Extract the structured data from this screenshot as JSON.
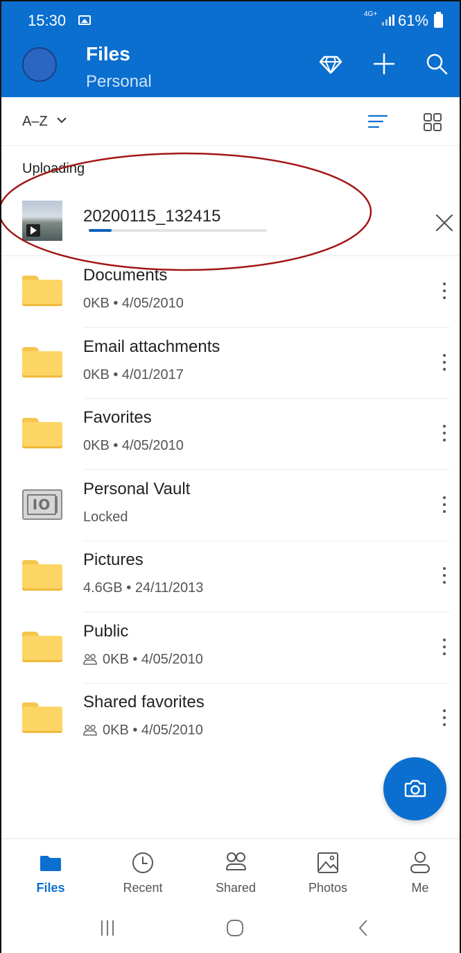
{
  "status_bar": {
    "time": "15:30",
    "network": "4G+",
    "battery": "61%"
  },
  "header": {
    "title": "Files",
    "subtitle": "Personal",
    "accent_color": "#0b6fd0"
  },
  "sort": {
    "label": "A–Z"
  },
  "uploading": {
    "section_label": "Uploading",
    "file_name": "20200115_132415",
    "progress": 0.13
  },
  "files": [
    {
      "name": "Documents",
      "meta": "0KB • 4/05/2010",
      "icon": "folder-icon",
      "shared": false
    },
    {
      "name": "Email attachments",
      "meta": "0KB • 4/01/2017",
      "icon": "folder-icon",
      "shared": false
    },
    {
      "name": "Favorites",
      "meta": "0KB • 4/05/2010",
      "icon": "folder-icon",
      "shared": false
    },
    {
      "name": "Personal Vault",
      "meta": "Locked",
      "icon": "vault-icon",
      "shared": false
    },
    {
      "name": "Pictures",
      "meta": "4.6GB • 24/11/2013",
      "icon": "folder-icon",
      "shared": false
    },
    {
      "name": "Public",
      "meta": "0KB • 4/05/2010",
      "icon": "folder-icon",
      "shared": true
    },
    {
      "name": "Shared favorites",
      "meta": "0KB • 4/05/2010",
      "icon": "folder-icon",
      "shared": true
    }
  ],
  "bottom_nav": [
    {
      "label": "Files",
      "icon": "folder-icon",
      "active": true
    },
    {
      "label": "Recent",
      "icon": "clock-icon",
      "active": false
    },
    {
      "label": "Shared",
      "icon": "people-icon",
      "active": false
    },
    {
      "label": "Photos",
      "icon": "image-icon",
      "active": false
    },
    {
      "label": "Me",
      "icon": "person-icon",
      "active": false
    }
  ]
}
